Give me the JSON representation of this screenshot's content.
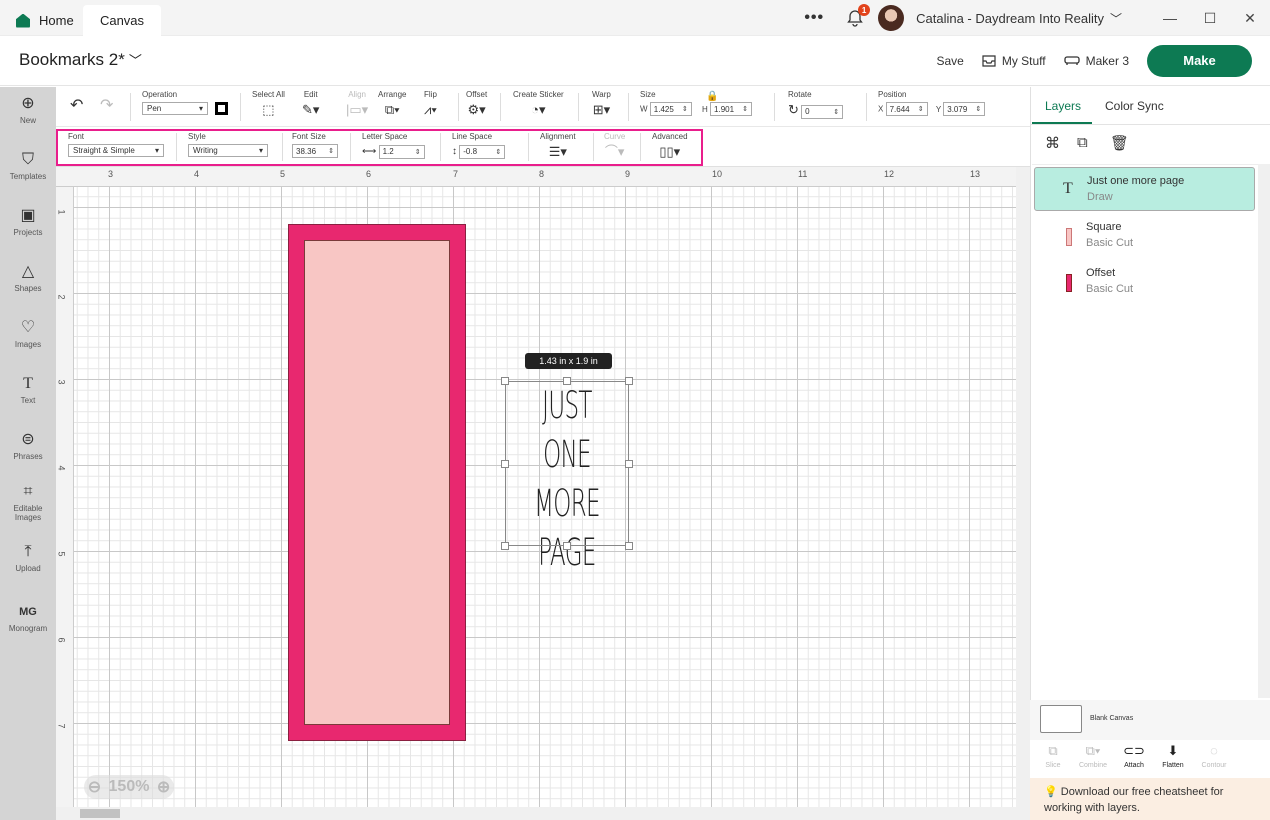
{
  "titlebar": {
    "tabs": [
      {
        "label": "Home"
      },
      {
        "label": "Canvas"
      }
    ],
    "more_label": "•••",
    "notifications_count": "1",
    "user_name": "Catalina - Daydream Into Reality",
    "window_controls": {
      "minimize": "—",
      "maximize": "☐",
      "close": "✕"
    }
  },
  "header": {
    "project_title": "Bookmarks 2*",
    "save_label": "Save",
    "mystuff_label": "My Stuff",
    "machine_label": "Maker 3",
    "make_label": "Make"
  },
  "sidebar": {
    "items": [
      {
        "label": "New",
        "icon": "⊕"
      },
      {
        "label": "Templates",
        "icon": "👕"
      },
      {
        "label": "Projects",
        "icon": "▣"
      },
      {
        "label": "Shapes",
        "icon": "△"
      },
      {
        "label": "Images",
        "icon": "♡"
      },
      {
        "label": "Text",
        "icon": "T"
      },
      {
        "label": "Phrases",
        "icon": "💬"
      },
      {
        "label": "Editable Images",
        "icon": "⌗"
      },
      {
        "label": "Upload",
        "icon": "⤒"
      },
      {
        "label": "Monogram",
        "icon": "MG"
      }
    ]
  },
  "toolbar": {
    "undo": "↶",
    "redo": "↷",
    "operation_label": "Operation",
    "operation_value": "Pen",
    "select_all_label": "Select All",
    "edit_label": "Edit",
    "align_label": "Align",
    "arrange_label": "Arrange",
    "flip_label": "Flip",
    "offset_label": "Offset",
    "create_sticker_label": "Create Sticker",
    "warp_label": "Warp",
    "size_label": "Size",
    "w_label": "W",
    "w_value": "1.425",
    "h_label": "H",
    "h_value": "1.901",
    "rotate_label": "Rotate",
    "rotate_value": "0",
    "position_label": "Position",
    "x_label": "X",
    "x_value": "7.644",
    "y_label": "Y",
    "y_value": "3.079"
  },
  "text_toolbar": {
    "font_label": "Font",
    "font_value": "Straight & Simple",
    "style_label": "Style",
    "style_value": "Writing",
    "font_size_label": "Font Size",
    "font_size_value": "38.36",
    "letter_space_label": "Letter Space",
    "letter_space_value": "1.2",
    "line_space_label": "Line Space",
    "line_space_value": "-0.8",
    "alignment_label": "Alignment",
    "curve_label": "Curve",
    "advanced_label": "Advanced",
    "highlight_color": "#e91e8c"
  },
  "rulers": {
    "top": [
      "3",
      "4",
      "5",
      "6",
      "7",
      "8",
      "9",
      "10",
      "11",
      "12",
      "13"
    ],
    "left": [
      "1",
      "2",
      "3",
      "4",
      "5",
      "6",
      "7"
    ]
  },
  "canvas": {
    "dimension_tag": "1.43  in x 1.9  in",
    "text_lines": [
      "JUST ONE",
      "MORE",
      "PAGE"
    ],
    "zoom_level": "150%",
    "offset_color": "#e8286f",
    "square_color": "#f8c6c4"
  },
  "layers_panel": {
    "tabs": [
      {
        "label": "Layers"
      },
      {
        "label": "Color Sync"
      }
    ],
    "layers": [
      {
        "name": "Just one more page",
        "operation": "Draw",
        "selected": true
      },
      {
        "name": "Square",
        "operation": "Basic Cut",
        "color": "#f8c6c4"
      },
      {
        "name": "Offset",
        "operation": "Basic Cut",
        "color": "#e8286f"
      }
    ],
    "blank_canvas_label": "Blank Canvas",
    "actions": [
      {
        "label": "Slice",
        "enabled": false
      },
      {
        "label": "Combine",
        "enabled": false
      },
      {
        "label": "Attach",
        "enabled": true
      },
      {
        "label": "Flatten",
        "enabled": true
      },
      {
        "label": "Contour",
        "enabled": false
      }
    ],
    "tip": "Download our free cheatsheet for working with layers."
  },
  "accent_color": "#0d7a53"
}
